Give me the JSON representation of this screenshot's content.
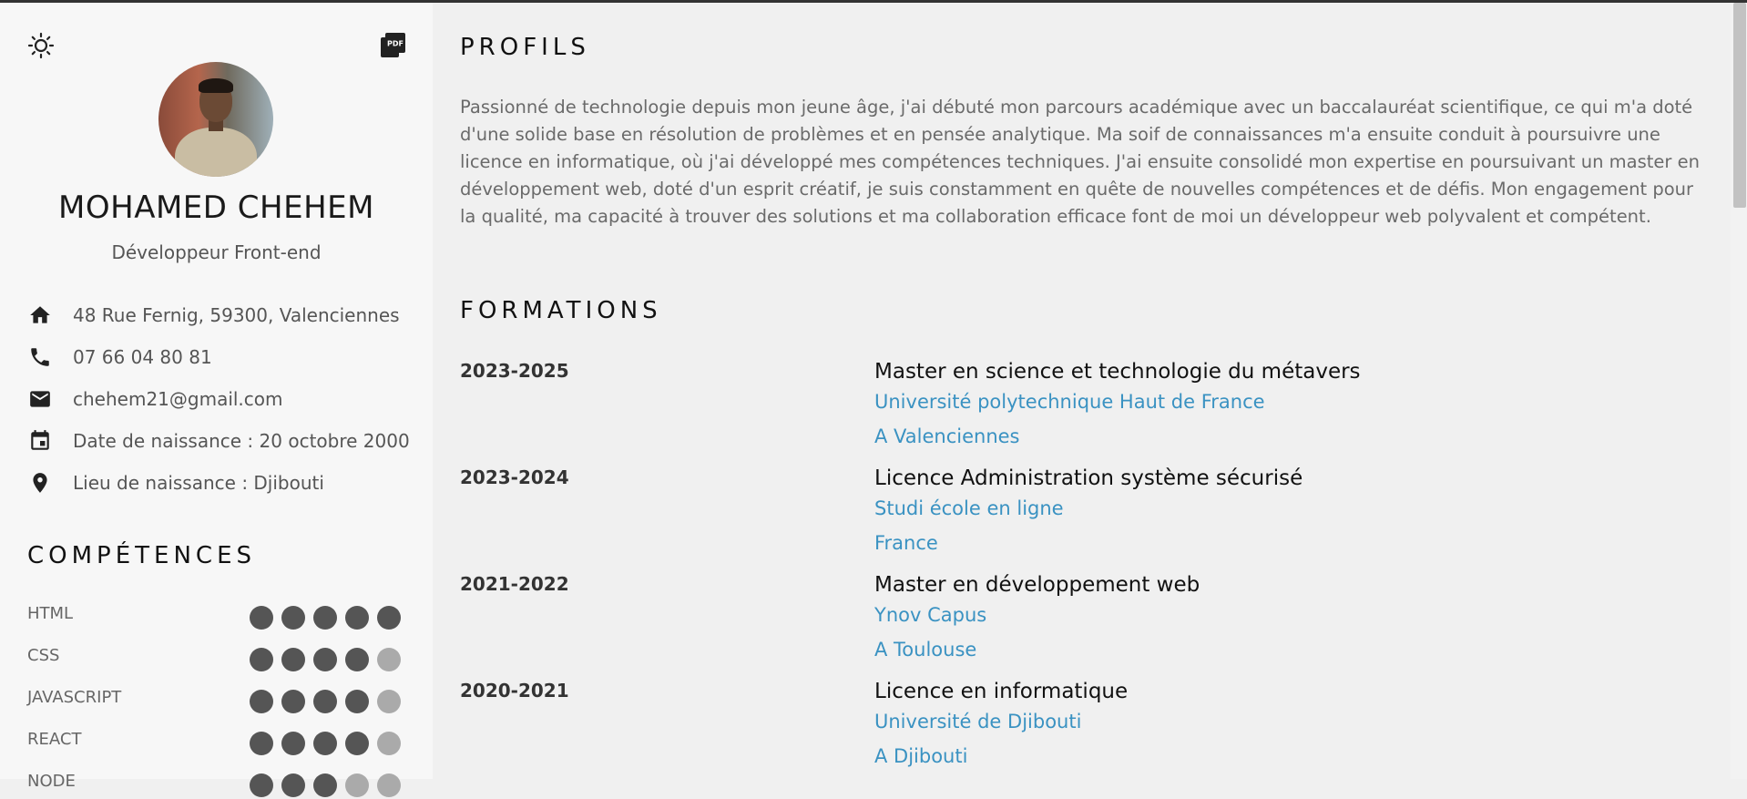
{
  "sidebar": {
    "theme_icon": "sun-icon",
    "pdf_icon": "pdf-icon",
    "pdf_label": "PDF",
    "name": "MOHAMED CHEHEM",
    "title": "Développeur Front-end",
    "contacts": [
      {
        "icon": "home-icon",
        "text": "48 Rue Fernig, 59300, Valenciennes"
      },
      {
        "icon": "phone-icon",
        "text": "07 66 04 80 81"
      },
      {
        "icon": "mail-icon",
        "text": "chehem21@gmail.com"
      },
      {
        "icon": "calendar-icon",
        "text": "Date de naissance : 20 octobre 2000"
      },
      {
        "icon": "location-pin-icon",
        "text": "Lieu de naissance : Djibouti"
      }
    ],
    "skills_title": "COMPÉTENCES",
    "skills": [
      {
        "label": "HTML",
        "level": 5,
        "max": 5
      },
      {
        "label": "CSS",
        "level": 4,
        "max": 5
      },
      {
        "label": "JAVASCRIPT",
        "level": 4,
        "max": 5
      },
      {
        "label": "REACT",
        "level": 4,
        "max": 5
      },
      {
        "label": "NODE",
        "level": 3,
        "max": 5
      }
    ]
  },
  "main": {
    "profile_title": "PROFILS",
    "profile_text": "Passionné de technologie depuis mon jeune âge, j'ai débuté mon parcours académique avec un baccalauréat scientifique, ce qui m'a doté d'une solide base en résolution de problèmes et en pensée analytique. Ma soif de connaissances m'a ensuite conduit à poursuivre une licence en informatique, où j'ai développé mes compétences techniques. J'ai ensuite consolidé mon expertise en poursuivant un master en développement web, doté d'un esprit créatif, je suis constamment en quête de nouvelles compétences et de défis. Mon engagement pour la qualité, ma capacité à trouver des solutions et ma collaboration efficace font de moi un développeur web polyvalent et compétent.",
    "formations_title": "FORMATIONS",
    "formations": [
      {
        "years": "2023-2025",
        "degree": "Master en science et technologie du métavers",
        "school": "Université polytechnique Haut de France",
        "place": "A Valenciennes"
      },
      {
        "years": "2023-2024",
        "degree": "Licence Administration système sécurisé",
        "school": "Studi école en ligne",
        "place": "France"
      },
      {
        "years": "2021-2022",
        "degree": "Master en développement web",
        "school": "Ynov Capus",
        "place": "A Toulouse"
      },
      {
        "years": "2020-2021",
        "degree": "Licence en informatique",
        "school": "Université de Djibouti",
        "place": "A Djibouti"
      }
    ]
  },
  "colors": {
    "accent": "#3a92c2",
    "dot_on": "#555555",
    "dot_off": "#aaaaaa"
  }
}
